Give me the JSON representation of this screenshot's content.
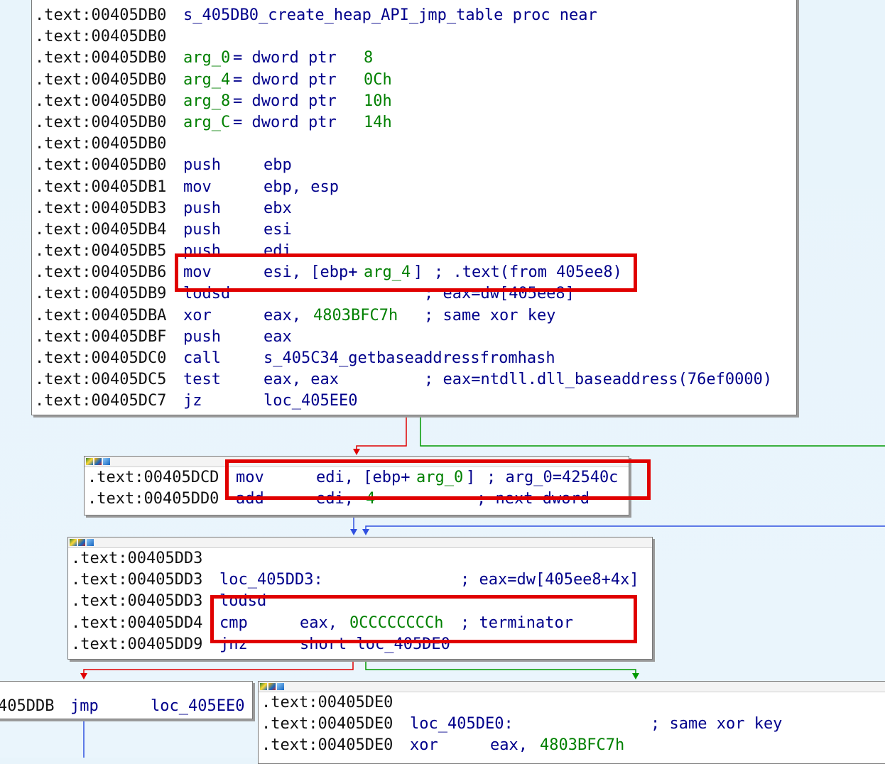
{
  "theme": {
    "accent_red": "#e00000",
    "edge_true": "#009900",
    "edge_false": "#e00000",
    "edge_loop": "#3050e0"
  },
  "block1": {
    "lines": [
      {
        "addr": ".text:00405DB0",
        "t1": "s_405DB0_create_heap_API_jmp_table proc near"
      },
      {
        "addr": ".text:00405DB0"
      },
      {
        "addr": ".text:00405DB0",
        "v": "arg_0",
        "t1": "= dword ptr",
        "n": "8"
      },
      {
        "addr": ".text:00405DB0",
        "v": "arg_4",
        "t1": "= dword ptr",
        "n": "0Ch"
      },
      {
        "addr": ".text:00405DB0",
        "v": "arg_8",
        "t1": "= dword ptr",
        "n": "10h"
      },
      {
        "addr": ".text:00405DB0",
        "v": "arg_C",
        "t1": "= dword ptr",
        "n": "14h"
      },
      {
        "addr": ".text:00405DB0"
      },
      {
        "addr": ".text:00405DB0",
        "mn": "push",
        "op": "ebp"
      },
      {
        "addr": ".text:00405DB1",
        "mn": "mov",
        "op": "ebp, esp"
      },
      {
        "addr": ".text:00405DB3",
        "mn": "push",
        "op": "ebx"
      },
      {
        "addr": ".text:00405DB4",
        "mn": "push",
        "op": "esi"
      },
      {
        "addr": ".text:00405DB5",
        "mn": "push",
        "op": "edi"
      },
      {
        "addr": ".text:00405DB6",
        "mn": "mov",
        "op": "esi, [ebp+",
        "opv": "arg_4",
        "op2": "]",
        "cm": "; .text(from 405ee8)"
      },
      {
        "addr": ".text:00405DB9",
        "mn": "lodsd",
        "cm": "; eax=dw[405ee8]"
      },
      {
        "addr": ".text:00405DBA",
        "mn": "xor",
        "op": "eax, ",
        "opn": "4803BFC7h",
        "cm": "; same xor key"
      },
      {
        "addr": ".text:00405DBF",
        "mn": "push",
        "op": "eax"
      },
      {
        "addr": ".text:00405DC0",
        "mn": "call",
        "op": "s_405C34_getbaseaddressfromhash"
      },
      {
        "addr": ".text:00405DC5",
        "mn": "test",
        "op": "eax, eax",
        "cm": "; eax=ntdll.dll_baseaddress(76ef0000)"
      },
      {
        "addr": ".text:00405DC7",
        "mn": "jz",
        "op": "loc_405EE0"
      }
    ]
  },
  "block2": {
    "lines": [
      {
        "addr": ".text:00405DCD",
        "mn": "mov",
        "op": "edi, [ebp+",
        "opv": "arg_0",
        "op2": "]",
        "cm": "; arg_0=42540c"
      },
      {
        "addr": ".text:00405DD0",
        "mn": "add",
        "op": "edi, ",
        "opn": "4",
        "cm": "; next dword"
      }
    ]
  },
  "block3": {
    "lines": [
      {
        "addr": ".text:00405DD3"
      },
      {
        "addr": ".text:00405DD3",
        "lbl": "loc_405DD3:",
        "cm": "; eax=dw[405ee8+4x]"
      },
      {
        "addr": ".text:00405DD3",
        "mn": "lodsd"
      },
      {
        "addr": ".text:00405DD4",
        "mn": "cmp",
        "op": "eax, ",
        "opn": "0CCCCCCCCh",
        "cm": "; terminator"
      },
      {
        "addr": ".text:00405DD9",
        "mn": "jnz",
        "op": "short loc_405DE0"
      }
    ]
  },
  "block4": {
    "lines": [
      {
        "addr": "405DDB",
        "mn": "jmp",
        "op": "loc_405EE0"
      }
    ]
  },
  "block5": {
    "lines": [
      {
        "addr": ".text:00405DE0"
      },
      {
        "addr": ".text:00405DE0",
        "lbl": "loc_405DE0:",
        "cm": "; same xor key"
      },
      {
        "addr": ".text:00405DE0",
        "mn": "xor",
        "op": "eax, ",
        "opn": "4803BFC7h"
      }
    ]
  }
}
